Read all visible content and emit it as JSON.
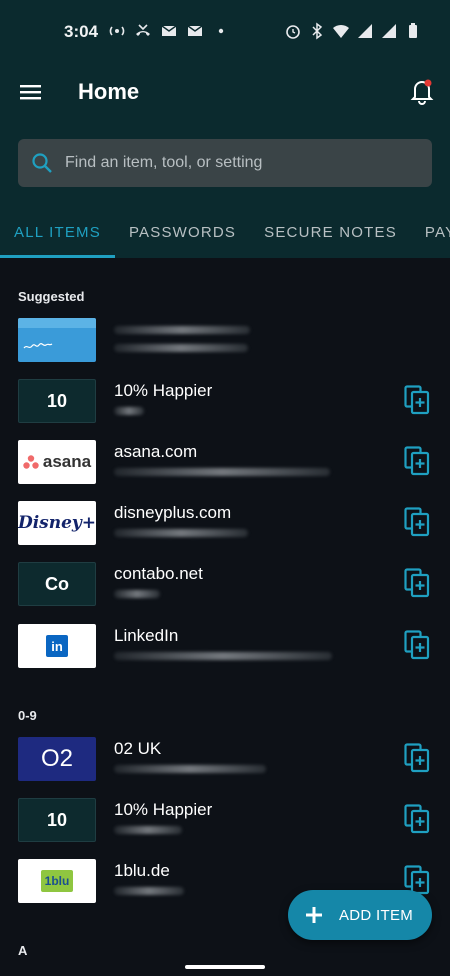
{
  "status": {
    "time": "3:04"
  },
  "header": {
    "title": "Home"
  },
  "search": {
    "placeholder": "Find an item, tool, or setting"
  },
  "tabs": [
    "ALL ITEMS",
    "PASSWORDS",
    "SECURE NOTES",
    "PAYM"
  ],
  "sections": {
    "suggested": "Suggested",
    "numeric": "0-9",
    "a": "A"
  },
  "suggested_items": [
    {
      "title": "",
      "thumb": "card-image"
    },
    {
      "title": "10% Happier",
      "thumb_text": "10"
    },
    {
      "title": "asana.com",
      "thumb_text": "asana"
    },
    {
      "title": "disneyplus.com",
      "thumb_text": "Disney+"
    },
    {
      "title": "contabo.net",
      "thumb_text": "Co"
    },
    {
      "title": "LinkedIn",
      "thumb_text": "in"
    }
  ],
  "numeric_items": [
    {
      "title": "02 UK",
      "thumb_text": "O2"
    },
    {
      "title": "10% Happier",
      "thumb_text": "10"
    },
    {
      "title": "1blu.de",
      "thumb_text": "1blu"
    }
  ],
  "fab": {
    "label": "ADD ITEM"
  },
  "colors": {
    "accent": "#1fa0c1",
    "app_bar": "#0b2a2e",
    "background": "#0d1117",
    "fab": "#1587a8"
  }
}
